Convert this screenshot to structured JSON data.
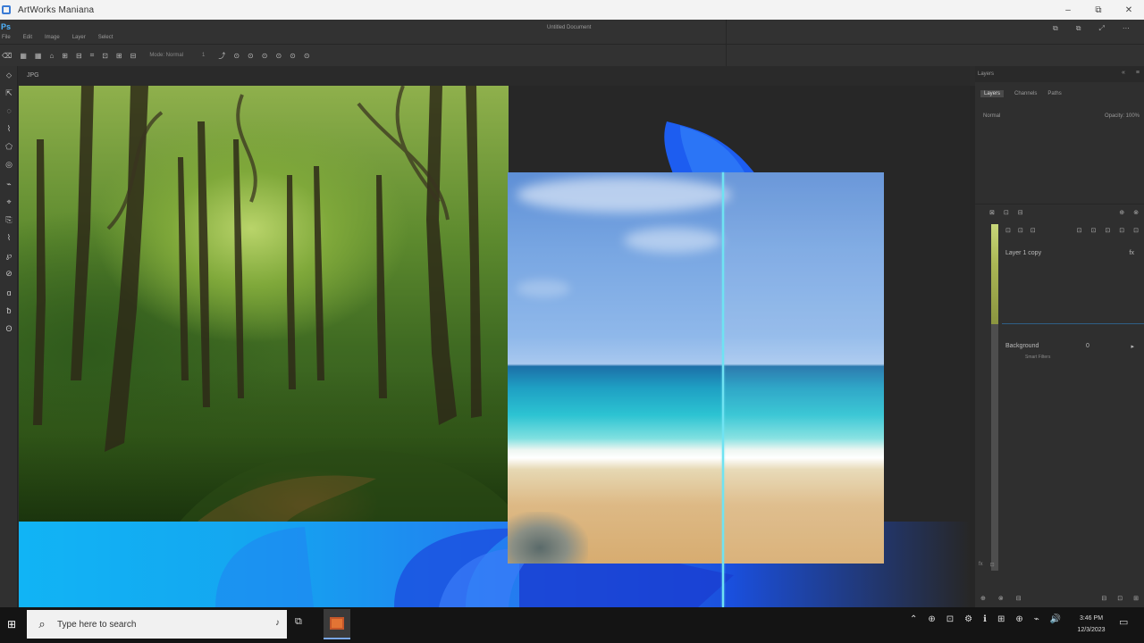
{
  "window": {
    "title": "ArtWorks Maniana",
    "controls": {
      "minimize": "–",
      "maximize": "⧉",
      "close": "✕"
    }
  },
  "menubar": {
    "logo": "Ps",
    "menus": [
      "File",
      "Edit",
      "Image",
      "Layer",
      "Select"
    ],
    "doc_title": "Untitled Document",
    "right_icons": [
      "⧉",
      "⧉",
      "⤢",
      "⋯"
    ]
  },
  "optionsbar": {
    "icons": [
      "⌫",
      "▦",
      "▦",
      "⌂",
      "⊞",
      "⊟",
      "⌗",
      "⊡",
      "⊞",
      "⊟"
    ],
    "field_label": "Mode: Normal",
    "field_value": "1",
    "icons_right": [
      "⤴",
      "⊙",
      "⊙",
      "⊙",
      "⊙",
      "⊙",
      "⊙"
    ]
  },
  "tabbar": {
    "doc_tab": "JPG"
  },
  "toolbox": {
    "tools": [
      "⬦",
      "⇱",
      "◌",
      "⌇",
      "⬠",
      "◎",
      "⌁",
      "⌖",
      "⎘",
      "⌇",
      "℘",
      "⊘",
      "ɑ",
      "ƀ",
      "ʘ"
    ]
  },
  "panels": {
    "header_label": "Layers",
    "header_icons": [
      "«",
      "≡"
    ],
    "tabs": [
      "Layers",
      "Channels",
      "Paths"
    ],
    "row1": {
      "left": "Normal",
      "right": "Opacity: 100%"
    },
    "layers_toolbar": [
      "⊠",
      "⊡",
      "⊟"
    ],
    "layers_toolbar_end": [
      "⊕",
      "⊗"
    ],
    "icons_row": [
      "⊡",
      "⊡",
      "⊡"
    ],
    "icons_row_end": [
      "⊡",
      "⊡",
      "⊡",
      "⊡",
      "⊡"
    ],
    "layer1": {
      "name": "Layer 1 copy",
      "right": "fx"
    },
    "layer2": {
      "name": "Background",
      "mid": "0",
      "right": "▸"
    },
    "sublayer": "Smart Filters",
    "side_buttons": [
      "fx",
      "⊡"
    ],
    "bottom_icons": [
      "⊕",
      "⊗",
      "⊟"
    ],
    "bottom_icons_end": [
      "⊟",
      "⊡",
      "⊞"
    ]
  },
  "taskbar": {
    "start": "⊞",
    "search_placeholder": "Type here to search",
    "search_icon": "⌕",
    "mic": "♪",
    "task_view": "⧉",
    "tray": [
      "⌃",
      "⊕",
      "⊡",
      "⚙",
      "ℹ",
      "⊞",
      "⊕",
      "⌁",
      "🔊"
    ],
    "time": "3:46 PM",
    "date": "12/3/2023",
    "notification": "▭"
  },
  "colors": {
    "accent": "#31a8ff",
    "guide": "#6fe3f2",
    "panel_bg": "#2f2f2f",
    "workspace_bg": "#272727"
  }
}
